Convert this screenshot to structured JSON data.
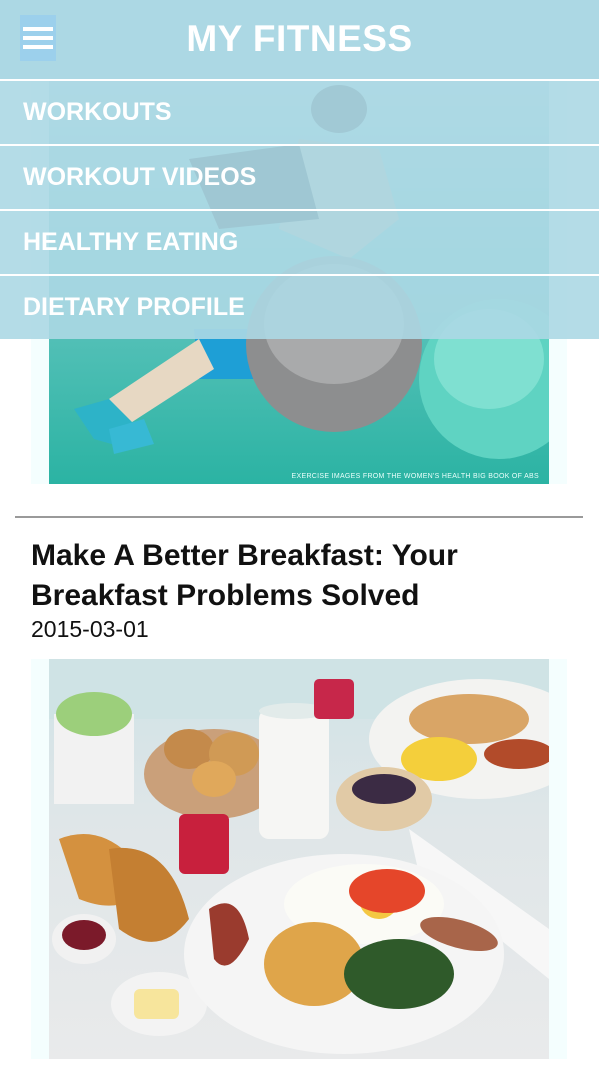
{
  "header": {
    "title": "MY FITNESS",
    "menu_icon": "hamburger-menu-icon"
  },
  "nav": {
    "items": [
      {
        "label": "WORKOUTS"
      },
      {
        "label": "WORKOUT VIDEOS"
      },
      {
        "label": "HEALTHY EATING"
      },
      {
        "label": "DIETARY PROFILE"
      }
    ]
  },
  "hero": {
    "caption": "EXERCISE IMAGES FROM THE WOMEN'S HEALTH BIG BOOK OF ABS"
  },
  "article": {
    "title": "Make A Better Breakfast: Your Breakfast Problems Solved",
    "date": "2015-03-01"
  },
  "colors": {
    "header_bg": "#acd8e4",
    "header_text": "#ffffff"
  }
}
